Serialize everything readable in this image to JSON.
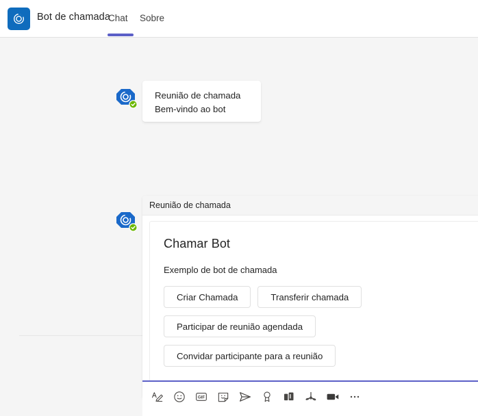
{
  "header": {
    "app_icon": "call-bot-app-icon",
    "app_title": "Bot de chamada",
    "tabs": [
      {
        "label": "Chat",
        "selected": true
      },
      {
        "label": "Sobre",
        "selected": false
      }
    ],
    "accent_color": "#5b5fc7",
    "icon_bg_color": "#0f6cbd"
  },
  "conversation": {
    "messages": [
      {
        "type": "text",
        "avatar": "bot-avatar-verified",
        "lines": [
          "Reunião de chamada",
          "Bem-vindo ao bot"
        ]
      },
      {
        "type": "card",
        "avatar": "bot-avatar-verified",
        "card_header": "Reunião de chamada",
        "title": "Chamar Bot",
        "subtitle": "Exemplo de bot de chamada",
        "actions": [
          {
            "label": "Criar Chamada"
          },
          {
            "label": "Transferir chamada"
          },
          {
            "label": "Participar de reunião agendada"
          },
          {
            "label": "Convidar participante para a reunião"
          }
        ]
      }
    ]
  },
  "compose": {
    "toolbar": [
      {
        "name": "format-icon",
        "title": "Formatar"
      },
      {
        "name": "emoji-icon",
        "title": "Emoji"
      },
      {
        "name": "gif-icon",
        "title": "GIF"
      },
      {
        "name": "sticker-icon",
        "title": "Adesivo"
      },
      {
        "name": "send-arrow-icon",
        "title": "Enviar"
      },
      {
        "name": "praise-badge-icon",
        "title": "Elogio"
      },
      {
        "name": "apps-icon",
        "title": "Aplicativos"
      },
      {
        "name": "adobe-acrobat-icon",
        "title": "Adobe Acrobat"
      },
      {
        "name": "video-camera-icon",
        "title": "Reunir agora"
      },
      {
        "name": "more-options-icon",
        "title": "Mais opções"
      }
    ]
  }
}
